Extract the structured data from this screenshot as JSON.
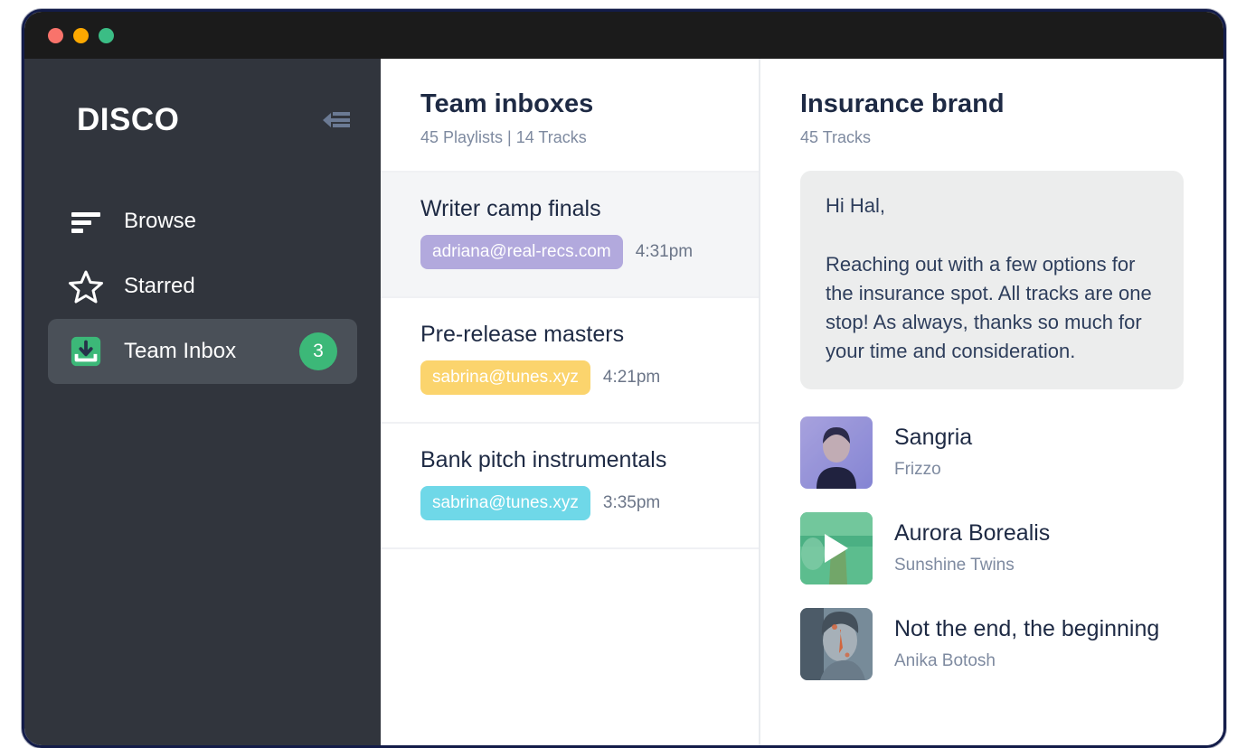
{
  "window": {
    "traffic_lights": [
      {
        "name": "close",
        "color": "#f9736b"
      },
      {
        "name": "minimize",
        "color": "#fca800"
      },
      {
        "name": "maximize",
        "color": "#3bbd85"
      }
    ]
  },
  "sidebar": {
    "brand": "DISCO",
    "collapse_icon": "collapse-arrow-icon",
    "items": [
      {
        "label": "Browse",
        "icon": "sort-lines-icon",
        "active": false,
        "badge": null
      },
      {
        "label": "Starred",
        "icon": "star-icon",
        "active": false,
        "badge": null
      },
      {
        "label": "Team Inbox",
        "icon": "inbox-down-icon",
        "active": true,
        "badge": "3"
      }
    ],
    "accent_green": "#3cb878",
    "background": "#31353d",
    "active_background": "#4a5058"
  },
  "list_column": {
    "title": "Team inboxes",
    "subtitle": "45 Playlists | 14 Tracks",
    "threads": [
      {
        "title": "Writer camp finals",
        "email": "adriana@real-recs.com",
        "chip_color": "#b2a9dd",
        "time": "4:31pm",
        "selected": true
      },
      {
        "title": "Pre-release masters",
        "email": "sabrina@tunes.xyz",
        "chip_color": "#fbd46d",
        "time": "4:21pm",
        "selected": false
      },
      {
        "title": "Bank pitch instrumentals",
        "email": "sabrina@tunes.xyz",
        "chip_color": "#6fd8e8",
        "time": "3:35pm",
        "selected": false
      }
    ]
  },
  "detail_column": {
    "title": "Insurance brand",
    "subtitle": "45 Tracks",
    "message": {
      "greeting": "Hi Hal,",
      "body": "Reaching out with a few options for the insurance spot. All tracks are one stop! As always, thanks so much for your time and consideration."
    },
    "tracks": [
      {
        "title": "Sangria",
        "artist": "Frizzo",
        "artwork": "portrait-purple-artwork",
        "playing": false
      },
      {
        "title": "Aurora Borealis",
        "artist": "Sunshine Twins",
        "artwork": "landscape-green-artwork",
        "playing": true
      },
      {
        "title": "Not the end, the beginning",
        "artist": "Anika Botosh",
        "artwork": "portrait-blue-artwork",
        "playing": false
      }
    ]
  }
}
